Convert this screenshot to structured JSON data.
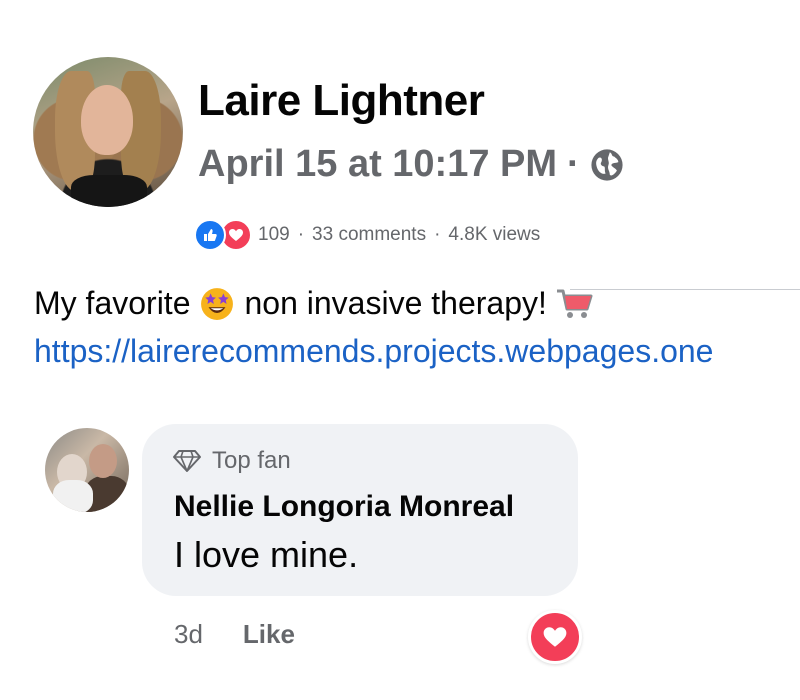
{
  "post": {
    "author": "Laire Lightner",
    "timestamp": "April 15 at 10:17 PM",
    "separator": "·",
    "privacy_icon": "globe-icon",
    "reactions": {
      "types": [
        "like",
        "love"
      ],
      "count": "109",
      "comments": "33 comments",
      "views": "4.8K views",
      "separator": "·"
    },
    "text_before_emoji": "My favorite",
    "emoji": "star-struck-emoji",
    "text_after_emoji": "non invasive therapy!",
    "trailing_icon": "shopping-cart-icon",
    "link": "https://lairerecommends.projects.webpages.one"
  },
  "comment": {
    "badge": "Top fan",
    "badge_icon": "diamond-icon",
    "author": "Nellie Longoria Monreal",
    "text": "I love mine.",
    "time": "3d",
    "like_label": "Like",
    "reaction": "love"
  },
  "colors": {
    "text_primary": "#050505",
    "text_secondary": "#65676b",
    "link": "#1b62c5",
    "like_blue": "#1877f2",
    "love_red": "#f33e58",
    "bubble_bg": "#f0f2f5"
  }
}
